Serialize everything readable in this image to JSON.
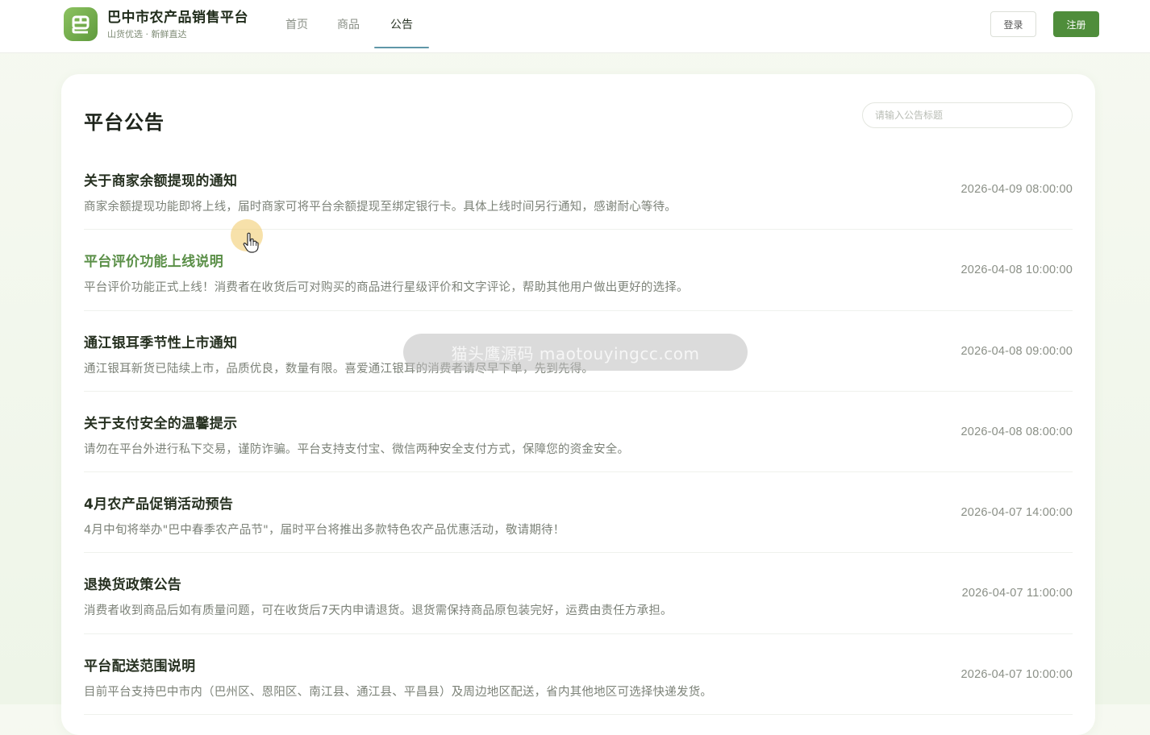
{
  "brand": {
    "logo_glyph": "巴",
    "title": "巴中市农产品销售平台",
    "subtitle": "山货优选 · 新鲜直达"
  },
  "nav": [
    {
      "label": "首页",
      "active": false
    },
    {
      "label": "商品",
      "active": false
    },
    {
      "label": "公告",
      "active": true
    }
  ],
  "auth": {
    "login_label": "登录",
    "register_label": "注册"
  },
  "page": {
    "title": "平台公告",
    "search_placeholder": "请输入公告标题"
  },
  "announcements": [
    {
      "title": "关于商家余额提现的通知",
      "desc": "商家余额提现功能即将上线，届时商家可将平台余额提现至绑定银行卡。具体上线时间另行通知，感谢耐心等待。",
      "time": "2026-04-09 08:00:00"
    },
    {
      "title": "平台评价功能上线说明",
      "desc": "平台评价功能正式上线！消费者在收货后可对购买的商品进行星级评价和文字评论，帮助其他用户做出更好的选择。",
      "time": "2026-04-08 10:00:00"
    },
    {
      "title": "通江银耳季节性上市通知",
      "desc": "通江银耳新货已陆续上市，品质优良，数量有限。喜爱通江银耳的消费者请尽早下单，先到先得。",
      "time": "2026-04-08 09:00:00"
    },
    {
      "title": "关于支付安全的温馨提示",
      "desc": "请勿在平台外进行私下交易，谨防诈骗。平台支持支付宝、微信两种安全支付方式，保障您的资金安全。",
      "time": "2026-04-08 08:00:00"
    },
    {
      "title": "4月农产品促销活动预告",
      "desc": "4月中旬将举办\"巴中春季农产品节\"，届时平台将推出多款特色农产品优惠活动，敬请期待！",
      "time": "2026-04-07 14:00:00"
    },
    {
      "title": "退换货政策公告",
      "desc": "消费者收到商品后如有质量问题，可在收货后7天内申请退货。退货需保持商品原包装完好，运费由责任方承担。",
      "time": "2026-04-07 11:00:00"
    },
    {
      "title": "平台配送范围说明",
      "desc": "目前平台支持巴中市内（巴州区、恩阳区、南江县、通江县、平昌县）及周边地区配送，省内其他地区可选择快递发货。",
      "time": "2026-04-07 10:00:00"
    }
  ],
  "overlay": {
    "watermark_text": "猫头鹰源码 maotouyingcc.com"
  },
  "colors": {
    "accent_green": "#4f8d3b",
    "hover_title_green": "#5a8f47",
    "nav_underline": "#5f97a8"
  }
}
